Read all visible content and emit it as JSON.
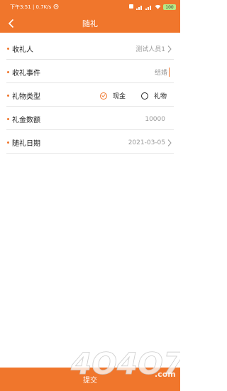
{
  "status": {
    "time_info": "下午3:51 | 0.7K/s",
    "battery": "100"
  },
  "nav": {
    "title": "随礼"
  },
  "form": {
    "recipient": {
      "label": "收礼人",
      "value": "测试人员1"
    },
    "event": {
      "label": "收礼事件",
      "value": "结婚"
    },
    "gift_type": {
      "label": "礼物类型",
      "options": [
        {
          "label": "现金",
          "selected": true
        },
        {
          "label": "礼物",
          "selected": false
        }
      ]
    },
    "amount": {
      "label": "礼金数额",
      "value": "10000"
    },
    "date": {
      "label": "随礼日期",
      "value": "2021-03-05"
    }
  },
  "footer": {
    "submit_label": "提交"
  },
  "watermark": {
    "text": "4O4O7.com"
  },
  "colors": {
    "accent": "#f0762c",
    "divider": "#e6e6e6",
    "value_text": "#999999"
  }
}
